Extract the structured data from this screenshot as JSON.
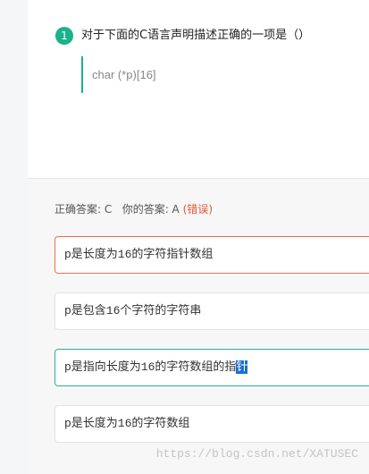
{
  "question": {
    "number": "1",
    "text": "对于下面的C语言声明描述正确的一项是（）",
    "code": "char (*p)[16]"
  },
  "answer": {
    "correct_label": "正确答案: C",
    "yours_label": "你的答案: A",
    "result_open": "(",
    "result": "错误",
    "result_close": ")"
  },
  "options": [
    {
      "text": "p是长度为16的字符指针数组",
      "state": "wrong"
    },
    {
      "text": "p是包含16个字符的字符串",
      "state": "neutral"
    },
    {
      "text_before": "p是指向长度为16的字符数组的指",
      "text_selected": "针",
      "state": "correct"
    },
    {
      "text": "p是长度为16的字符数组",
      "state": "neutral"
    }
  ],
  "watermark": "https://blog.csdn.net/XATUSEC",
  "colors": {
    "accent": "#1bb28a",
    "error": "#e4573a",
    "selection": "#1a6fd0"
  }
}
